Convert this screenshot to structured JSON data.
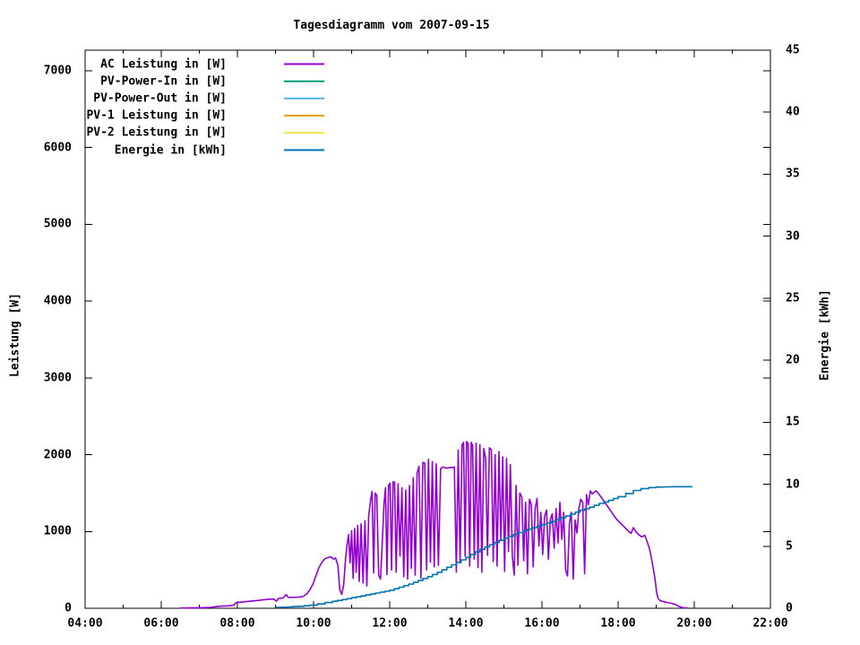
{
  "chart_data": {
    "type": "line",
    "title": "Tagesdiagramm vom 2007-09-15",
    "x_axis": {
      "tick_labels": [
        "04:00",
        "06:00",
        "08:00",
        "10:00",
        "12:00",
        "14:00",
        "16:00",
        "18:00",
        "20:00",
        "22:00"
      ],
      "tick_hours": [
        4,
        6,
        8,
        10,
        12,
        14,
        16,
        18,
        20,
        22
      ],
      "minor_tick_hours": [
        5,
        7,
        9,
        11,
        13,
        15,
        17,
        19,
        21
      ],
      "range_hours": [
        4,
        22
      ]
    },
    "y_axis": {
      "label": "Leistung [W]",
      "ticks": [
        0,
        1000,
        2000,
        3000,
        4000,
        5000,
        6000,
        7000
      ],
      "range": [
        0,
        7268
      ]
    },
    "y2_axis": {
      "label": "Energie [kWh]",
      "ticks": [
        0,
        5,
        10,
        15,
        20,
        25,
        30,
        35,
        40,
        45
      ],
      "range": [
        0,
        45
      ]
    },
    "legend": [
      {
        "label": "AC Leistung in [W]",
        "color": "#9400D3"
      },
      {
        "label": "PV-Power-In in [W]",
        "color": "#009E73"
      },
      {
        "label": "PV-Power-Out in [W]",
        "color": "#56B4E9"
      },
      {
        "label": "PV-1 Leistung in [W]",
        "color": "#E69F00"
      },
      {
        "label": "PV-2 Leistung in [W]",
        "color": "#F0E442"
      },
      {
        "label": "Energie in [kWh]",
        "color": "#0072B2"
      }
    ],
    "series": [
      {
        "name": "AC Leistung in [W]",
        "color": "#9400D3",
        "axis": "y",
        "style": "line",
        "points": [
          [
            6.5,
            3
          ],
          [
            6.8,
            5
          ],
          [
            7.1,
            8
          ],
          [
            7.3,
            12
          ],
          [
            7.45,
            22
          ],
          [
            7.6,
            28
          ],
          [
            7.75,
            32
          ],
          [
            7.9,
            40
          ],
          [
            7.95,
            68
          ],
          [
            8.05,
            78
          ],
          [
            8.2,
            85
          ],
          [
            8.35,
            92
          ],
          [
            8.5,
            100
          ],
          [
            8.65,
            108
          ],
          [
            8.8,
            115
          ],
          [
            8.95,
            120
          ],
          [
            9.03,
            93
          ],
          [
            9.08,
            128
          ],
          [
            9.2,
            133
          ],
          [
            9.28,
            180
          ],
          [
            9.34,
            140
          ],
          [
            9.45,
            142
          ],
          [
            9.6,
            145
          ],
          [
            9.72,
            152
          ],
          [
            9.82,
            185
          ],
          [
            9.9,
            240
          ],
          [
            9.98,
            310
          ],
          [
            10.06,
            420
          ],
          [
            10.14,
            530
          ],
          [
            10.22,
            600
          ],
          [
            10.3,
            645
          ],
          [
            10.38,
            660
          ],
          [
            10.46,
            668
          ],
          [
            10.52,
            640
          ],
          [
            10.58,
            655
          ],
          [
            10.64,
            560
          ],
          [
            10.69,
            240
          ],
          [
            10.74,
            180
          ],
          [
            10.79,
            300
          ],
          [
            10.84,
            640
          ],
          [
            10.88,
            820
          ],
          [
            10.92,
            960
          ],
          [
            10.96,
            590
          ],
          [
            11.0,
            1010
          ],
          [
            11.04,
            390
          ],
          [
            11.08,
            1040
          ],
          [
            11.12,
            470
          ],
          [
            11.16,
            1080
          ],
          [
            11.2,
            350
          ],
          [
            11.25,
            1100
          ],
          [
            11.3,
            330
          ],
          [
            11.35,
            1140
          ],
          [
            11.4,
            290
          ],
          [
            11.45,
            1210
          ],
          [
            11.5,
            1420
          ],
          [
            11.54,
            1520
          ],
          [
            11.58,
            460
          ],
          [
            11.62,
            1500
          ],
          [
            11.66,
            1470
          ],
          [
            11.71,
            430
          ],
          [
            11.76,
            380
          ],
          [
            11.81,
            900
          ],
          [
            11.85,
            1350
          ],
          [
            11.89,
            1570
          ],
          [
            11.93,
            440
          ],
          [
            11.97,
            1600
          ],
          [
            12.01,
            1630
          ],
          [
            12.05,
            500
          ],
          [
            12.09,
            1650
          ],
          [
            12.13,
            1640
          ],
          [
            12.17,
            470
          ],
          [
            12.22,
            1620
          ],
          [
            12.27,
            680
          ],
          [
            12.32,
            1570
          ],
          [
            12.37,
            410
          ],
          [
            12.42,
            1540
          ],
          [
            12.47,
            380
          ],
          [
            12.52,
            1600
          ],
          [
            12.57,
            520
          ],
          [
            12.62,
            1700
          ],
          [
            12.67,
            430
          ],
          [
            12.72,
            1760
          ],
          [
            12.77,
            1850
          ],
          [
            12.82,
            390
          ],
          [
            12.87,
            1900
          ],
          [
            12.92,
            1890
          ],
          [
            12.97,
            500
          ],
          [
            13.02,
            1940
          ],
          [
            13.07,
            600
          ],
          [
            13.12,
            1910
          ],
          [
            13.17,
            540
          ],
          [
            13.22,
            1880
          ],
          [
            13.28,
            560
          ],
          [
            13.34,
            1820
          ],
          [
            13.4,
            1840
          ],
          [
            13.46,
            1830
          ],
          [
            13.52,
            1825
          ],
          [
            13.58,
            1835
          ],
          [
            13.64,
            1830
          ],
          [
            13.7,
            1840
          ],
          [
            13.75,
            470
          ],
          [
            13.8,
            2060
          ],
          [
            13.85,
            590
          ],
          [
            13.9,
            2130
          ],
          [
            13.94,
            2160
          ],
          [
            13.98,
            680
          ],
          [
            14.02,
            2170
          ],
          [
            14.06,
            2150
          ],
          [
            14.1,
            550
          ],
          [
            14.14,
            2160
          ],
          [
            14.18,
            2120
          ],
          [
            14.22,
            640
          ],
          [
            14.27,
            2150
          ],
          [
            14.32,
            530
          ],
          [
            14.37,
            2130
          ],
          [
            14.42,
            470
          ],
          [
            14.47,
            2080
          ],
          [
            14.52,
            1950
          ],
          [
            14.57,
            690
          ],
          [
            14.62,
            2090
          ],
          [
            14.67,
            2060
          ],
          [
            14.72,
            610
          ],
          [
            14.77,
            2000
          ],
          [
            14.82,
            550
          ],
          [
            14.87,
            2040
          ],
          [
            14.92,
            880
          ],
          [
            14.97,
            1970
          ],
          [
            15.02,
            480
          ],
          [
            15.07,
            1950
          ],
          [
            15.12,
            740
          ],
          [
            15.17,
            1870
          ],
          [
            15.22,
            680
          ],
          [
            15.27,
            430
          ],
          [
            15.32,
            1600
          ],
          [
            15.37,
            560
          ],
          [
            15.42,
            1500
          ],
          [
            15.47,
            1450
          ],
          [
            15.52,
            620
          ],
          [
            15.57,
            1380
          ],
          [
            15.62,
            450
          ],
          [
            15.67,
            1420
          ],
          [
            15.72,
            1350
          ],
          [
            15.77,
            540
          ],
          [
            15.82,
            1300
          ],
          [
            15.87,
            1430
          ],
          [
            15.92,
            810
          ],
          [
            15.97,
            1250
          ],
          [
            16.02,
            700
          ],
          [
            16.07,
            1200
          ],
          [
            16.12,
            1280
          ],
          [
            16.17,
            640
          ],
          [
            16.22,
            1150
          ],
          [
            16.27,
            1230
          ],
          [
            16.32,
            780
          ],
          [
            16.37,
            1300
          ],
          [
            16.42,
            850
          ],
          [
            16.47,
            1380
          ],
          [
            16.52,
            900
          ],
          [
            16.57,
            1250
          ],
          [
            16.62,
            500
          ],
          [
            16.67,
            420
          ],
          [
            16.72,
            1100
          ],
          [
            16.77,
            1250
          ],
          [
            16.82,
            380
          ],
          [
            16.87,
            1150
          ],
          [
            16.92,
            980
          ],
          [
            16.97,
            1300
          ],
          [
            17.02,
            1420
          ],
          [
            17.07,
            1380
          ],
          [
            17.12,
            450
          ],
          [
            17.17,
            1480
          ],
          [
            17.22,
            1350
          ],
          [
            17.27,
            1530
          ],
          [
            17.32,
            1490
          ],
          [
            17.37,
            1510
          ],
          [
            17.42,
            1530
          ],
          [
            17.47,
            1500
          ],
          [
            17.52,
            1470
          ],
          [
            17.58,
            1430
          ],
          [
            17.65,
            1380
          ],
          [
            17.72,
            1330
          ],
          [
            17.8,
            1270
          ],
          [
            17.88,
            1215
          ],
          [
            17.96,
            1160
          ],
          [
            18.04,
            1120
          ],
          [
            18.12,
            1080
          ],
          [
            18.2,
            1040
          ],
          [
            18.28,
            1000
          ],
          [
            18.34,
            975
          ],
          [
            18.4,
            1050
          ],
          [
            18.46,
            1000
          ],
          [
            18.54,
            960
          ],
          [
            18.62,
            930
          ],
          [
            18.7,
            950
          ],
          [
            18.76,
            870
          ],
          [
            18.82,
            780
          ],
          [
            18.88,
            640
          ],
          [
            18.93,
            500
          ],
          [
            18.97,
            380
          ],
          [
            19.01,
            210
          ],
          [
            19.05,
            130
          ],
          [
            19.1,
            100
          ],
          [
            19.2,
            85
          ],
          [
            19.3,
            75
          ],
          [
            19.4,
            65
          ],
          [
            19.5,
            50
          ],
          [
            19.58,
            30
          ],
          [
            19.66,
            12
          ],
          [
            19.75,
            6
          ],
          [
            19.82,
            4
          ]
        ]
      },
      {
        "name": "PV-Power-In in [W]",
        "color": "#009E73",
        "axis": "y",
        "style": "line",
        "points": []
      },
      {
        "name": "PV-Power-Out in [W]",
        "color": "#56B4E9",
        "axis": "y",
        "style": "line",
        "points": []
      },
      {
        "name": "PV-1 Leistung in [W]",
        "color": "#E69F00",
        "axis": "y",
        "style": "line",
        "points": []
      },
      {
        "name": "PV-2 Leistung in [W]",
        "color": "#F0E442",
        "axis": "y",
        "style": "line",
        "points": []
      },
      {
        "name": "Energie in [kWh]",
        "color": "#0072B2",
        "axis": "y2",
        "style": "steps",
        "points": [
          [
            9.0,
            0.07
          ],
          [
            9.3,
            0.11
          ],
          [
            9.6,
            0.16
          ],
          [
            9.9,
            0.25
          ],
          [
            10.1,
            0.35
          ],
          [
            10.3,
            0.46
          ],
          [
            10.5,
            0.56
          ],
          [
            10.75,
            0.7
          ],
          [
            11.0,
            0.85
          ],
          [
            11.25,
            1.0
          ],
          [
            11.5,
            1.15
          ],
          [
            11.75,
            1.3
          ],
          [
            12.0,
            1.45
          ],
          [
            12.25,
            1.7
          ],
          [
            12.5,
            1.95
          ],
          [
            12.75,
            2.25
          ],
          [
            13.0,
            2.55
          ],
          [
            13.25,
            2.9
          ],
          [
            13.5,
            3.3
          ],
          [
            13.75,
            3.7
          ],
          [
            14.0,
            4.1
          ],
          [
            14.25,
            4.55
          ],
          [
            14.5,
            4.95
          ],
          [
            14.75,
            5.3
          ],
          [
            15.0,
            5.65
          ],
          [
            15.25,
            5.95
          ],
          [
            15.5,
            6.25
          ],
          [
            15.75,
            6.5
          ],
          [
            16.0,
            6.75
          ],
          [
            16.25,
            7.0
          ],
          [
            16.5,
            7.3
          ],
          [
            16.75,
            7.6
          ],
          [
            17.0,
            7.9
          ],
          [
            17.25,
            8.15
          ],
          [
            17.5,
            8.45
          ],
          [
            17.75,
            8.7
          ],
          [
            18.0,
            9.0
          ],
          [
            18.2,
            9.25
          ],
          [
            18.4,
            9.5
          ],
          [
            18.6,
            9.65
          ],
          [
            18.8,
            9.73
          ],
          [
            19.0,
            9.77
          ],
          [
            19.2,
            9.79
          ],
          [
            19.4,
            9.8
          ],
          [
            19.95,
            9.8
          ]
        ]
      }
    ]
  }
}
